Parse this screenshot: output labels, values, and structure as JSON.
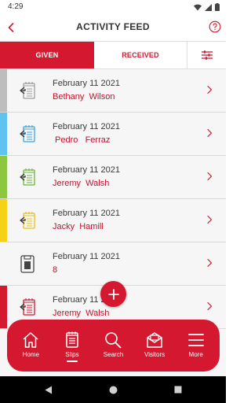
{
  "status_bar": {
    "time": "4:29"
  },
  "header": {
    "title": "ACTIVITY FEED"
  },
  "tabs": {
    "given": "GIVEN",
    "received": "RECEIVED"
  },
  "feed": [
    {
      "date": "February 11 2021",
      "name": "Bethany  Wilson",
      "stripe_color": "#bdbdbd",
      "icon_color": "#9e9e9e",
      "icon": "slip-icon"
    },
    {
      "date": "February 11 2021",
      "name": " Pedro   Ferraz",
      "stripe_color": "#5ec3f0",
      "icon_color": "#3aa6e0",
      "icon": "slip-icon"
    },
    {
      "date": "February 11 2021",
      "name": "Jeremy  Walsh",
      "stripe_color": "#8dc63f",
      "icon_color": "#6db33f",
      "icon": "slip-icon"
    },
    {
      "date": "February 11 2021",
      "name": "Jacky  Hamill",
      "stripe_color": "#f7d117",
      "icon_color": "#e8c21a",
      "icon": "slip-icon"
    },
    {
      "date": "February 11 2021",
      "name": "8",
      "stripe_color": "",
      "icon_color": "#444444",
      "icon": "document-icon"
    },
    {
      "date": "February 11 2021",
      "name": "Jeremy  Walsh",
      "stripe_color": "#d3182f",
      "icon_color": "#d3182f",
      "icon": "slip-icon"
    }
  ],
  "bottom_nav": [
    {
      "label": "Home",
      "icon": "home-icon"
    },
    {
      "label": "Slips",
      "icon": "slips-icon",
      "active": true
    },
    {
      "label": "Search",
      "icon": "search-icon"
    },
    {
      "label": "Visitors",
      "icon": "visitors-icon"
    },
    {
      "label": "More",
      "icon": "menu-icon"
    }
  ],
  "colors": {
    "brand": "#d3182f",
    "name_text": "#c8102e"
  }
}
